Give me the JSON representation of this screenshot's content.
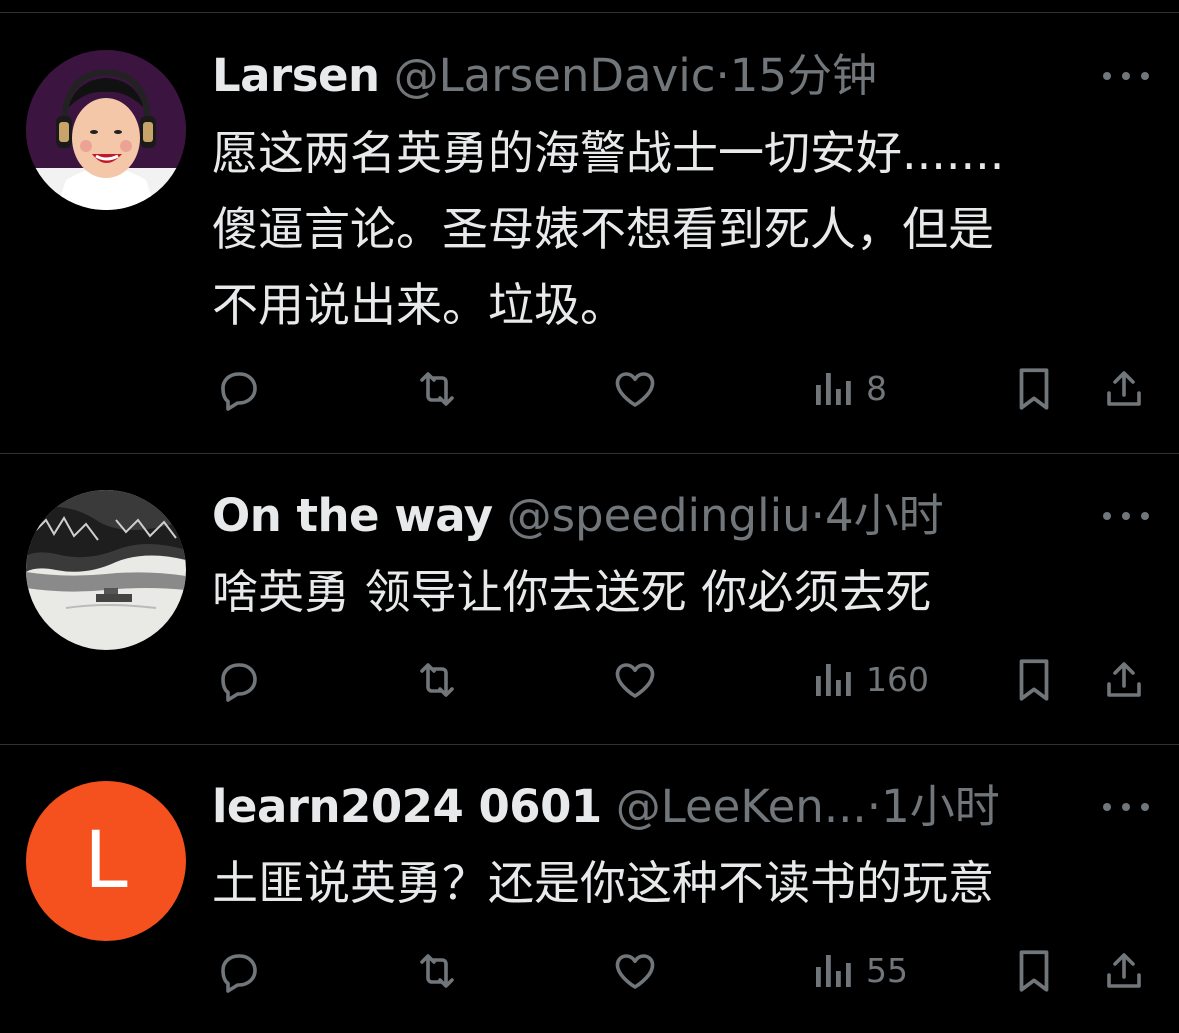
{
  "colors": {
    "background": "#000000",
    "primary_text": "#e7e9ea",
    "secondary_text": "#71767b",
    "divider": "#2f3336",
    "letter_avatar_bg": "#f4511e"
  },
  "tweets": [
    {
      "name": "Larsen",
      "handle": "@LarsenDavic",
      "separator": "·",
      "time": "15分钟",
      "text": "愿这两名英勇的海警战士一切安好.......\n傻逼言论。圣母婊不想看到死人，但是\n不用说出来。垃圾。",
      "views": "8",
      "avatar": "photo"
    },
    {
      "name": "On the way",
      "handle": "@speedingliu",
      "separator": "·",
      "time": "4小时",
      "text": "啥英勇 领导让你去送死 你必须去死",
      "views": "160",
      "avatar": "landscape"
    },
    {
      "name": "learn2024 0601",
      "handle": "@LeeKen...",
      "separator": "·",
      "time": "1小时",
      "text": "土匪说英勇？还是你这种不读书的玩意",
      "views": "55",
      "avatar": "letter",
      "avatar_letter": "L"
    }
  ],
  "icons": {
    "reply": "reply-icon",
    "retweet": "retweet-icon",
    "like": "heart-icon",
    "views": "views-chart-icon",
    "bookmark": "bookmark-icon",
    "share": "share-icon",
    "more": "more-dots-icon"
  }
}
